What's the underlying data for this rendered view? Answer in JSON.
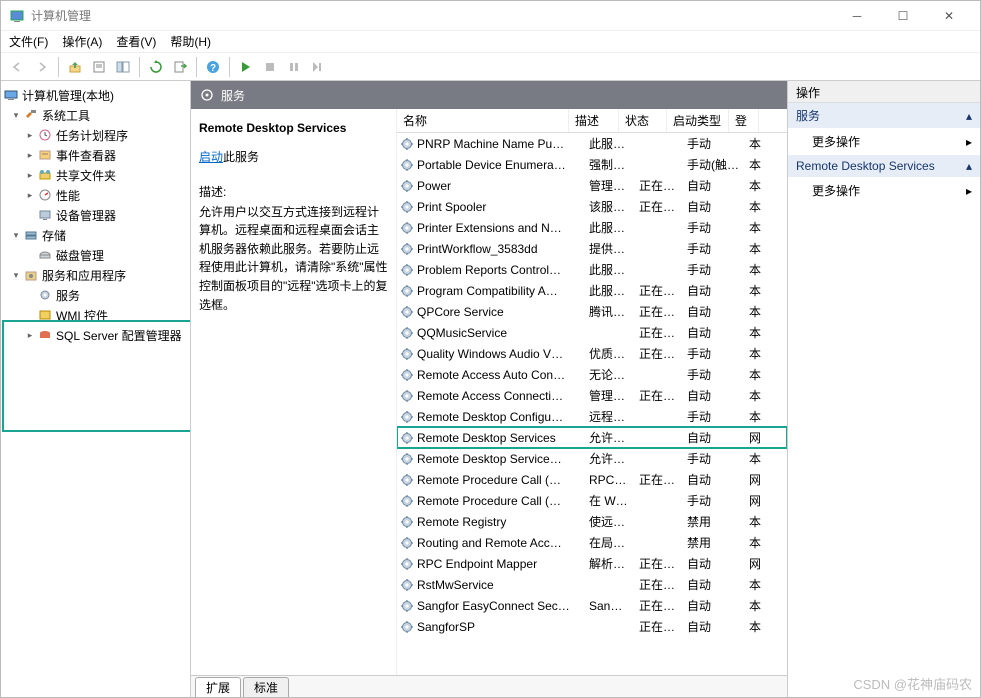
{
  "title": "计算机管理",
  "menus": [
    "文件(F)",
    "操作(A)",
    "查看(V)",
    "帮助(H)"
  ],
  "tree_root": "计算机管理(本地)",
  "tree": {
    "systools": "系统工具",
    "task_scheduler": "任务计划程序",
    "event_viewer": "事件查看器",
    "shared_folders": "共享文件夹",
    "performance": "性能",
    "device_mgr": "设备管理器",
    "storage": "存储",
    "disk_mgmt": "磁盘管理",
    "svc_apps": "服务和应用程序",
    "services": "服务",
    "wmi": "WMI 控件",
    "sqlserver": "SQL Server 配置管理器"
  },
  "svc_header": "服务",
  "detail": {
    "title": "Remote Desktop Services",
    "start_link": "启动",
    "start_suffix": "此服务",
    "desc_label": "描述:",
    "desc": "允许用户以交互方式连接到远程计算机。远程桌面和远程桌面会话主机服务器依赖此服务。若要防止远程使用此计算机，请清除\"系统\"属性控制面板项目的\"远程\"选项卡上的复选框。"
  },
  "columns": {
    "name": "名称",
    "desc": "描述",
    "state": "状态",
    "start": "启动类型",
    "logon": "登"
  },
  "services": [
    {
      "name": "PNRP Machine Name Pu…",
      "desc": "此服…",
      "state": "",
      "start": "手动",
      "logon": "本"
    },
    {
      "name": "Portable Device Enumera…",
      "desc": "强制…",
      "state": "",
      "start": "手动(触发…",
      "logon": "本"
    },
    {
      "name": "Power",
      "desc": "管理…",
      "state": "正在…",
      "start": "自动",
      "logon": "本"
    },
    {
      "name": "Print Spooler",
      "desc": "该服…",
      "state": "正在…",
      "start": "自动",
      "logon": "本"
    },
    {
      "name": "Printer Extensions and N…",
      "desc": "此服…",
      "state": "",
      "start": "手动",
      "logon": "本"
    },
    {
      "name": "PrintWorkflow_3583dd",
      "desc": "提供…",
      "state": "",
      "start": "手动",
      "logon": "本"
    },
    {
      "name": "Problem Reports Control…",
      "desc": "此服…",
      "state": "",
      "start": "手动",
      "logon": "本"
    },
    {
      "name": "Program Compatibility A…",
      "desc": "此服…",
      "state": "正在…",
      "start": "自动",
      "logon": "本"
    },
    {
      "name": "QPCore Service",
      "desc": "腾讯…",
      "state": "正在…",
      "start": "自动",
      "logon": "本"
    },
    {
      "name": "QQMusicService",
      "desc": "",
      "state": "正在…",
      "start": "自动",
      "logon": "本"
    },
    {
      "name": "Quality Windows Audio V…",
      "desc": "优质…",
      "state": "正在…",
      "start": "手动",
      "logon": "本"
    },
    {
      "name": "Remote Access Auto Con…",
      "desc": "无论…",
      "state": "",
      "start": "手动",
      "logon": "本"
    },
    {
      "name": "Remote Access Connecti…",
      "desc": "管理…",
      "state": "正在…",
      "start": "自动",
      "logon": "本"
    },
    {
      "name": "Remote Desktop Configu…",
      "desc": "远程…",
      "state": "",
      "start": "手动",
      "logon": "本"
    },
    {
      "name": "Remote Desktop Services",
      "desc": "允许…",
      "state": "",
      "start": "自动",
      "logon": "网",
      "hl": true
    },
    {
      "name": "Remote Desktop Service…",
      "desc": "允许…",
      "state": "",
      "start": "手动",
      "logon": "本"
    },
    {
      "name": "Remote Procedure Call (…",
      "desc": "RPC…",
      "state": "正在…",
      "start": "自动",
      "logon": "网"
    },
    {
      "name": "Remote Procedure Call (…",
      "desc": "在 W…",
      "state": "",
      "start": "手动",
      "logon": "网"
    },
    {
      "name": "Remote Registry",
      "desc": "使远…",
      "state": "",
      "start": "禁用",
      "logon": "本"
    },
    {
      "name": "Routing and Remote Acc…",
      "desc": "在局…",
      "state": "",
      "start": "禁用",
      "logon": "本"
    },
    {
      "name": "RPC Endpoint Mapper",
      "desc": "解析…",
      "state": "正在…",
      "start": "自动",
      "logon": "网"
    },
    {
      "name": "RstMwService",
      "desc": "",
      "state": "正在…",
      "start": "自动",
      "logon": "本"
    },
    {
      "name": "Sangfor EasyConnect Sec…",
      "desc": "San…",
      "state": "正在…",
      "start": "自动",
      "logon": "本"
    },
    {
      "name": "SangforSP",
      "desc": "",
      "state": "正在…",
      "start": "自动",
      "logon": "本"
    }
  ],
  "tabs": {
    "extended": "扩展",
    "standard": "标准"
  },
  "actions": {
    "header": "操作",
    "services": "服务",
    "more": "更多操作",
    "rds": "Remote Desktop Services"
  },
  "watermark": "CSDN @花神庙码农"
}
